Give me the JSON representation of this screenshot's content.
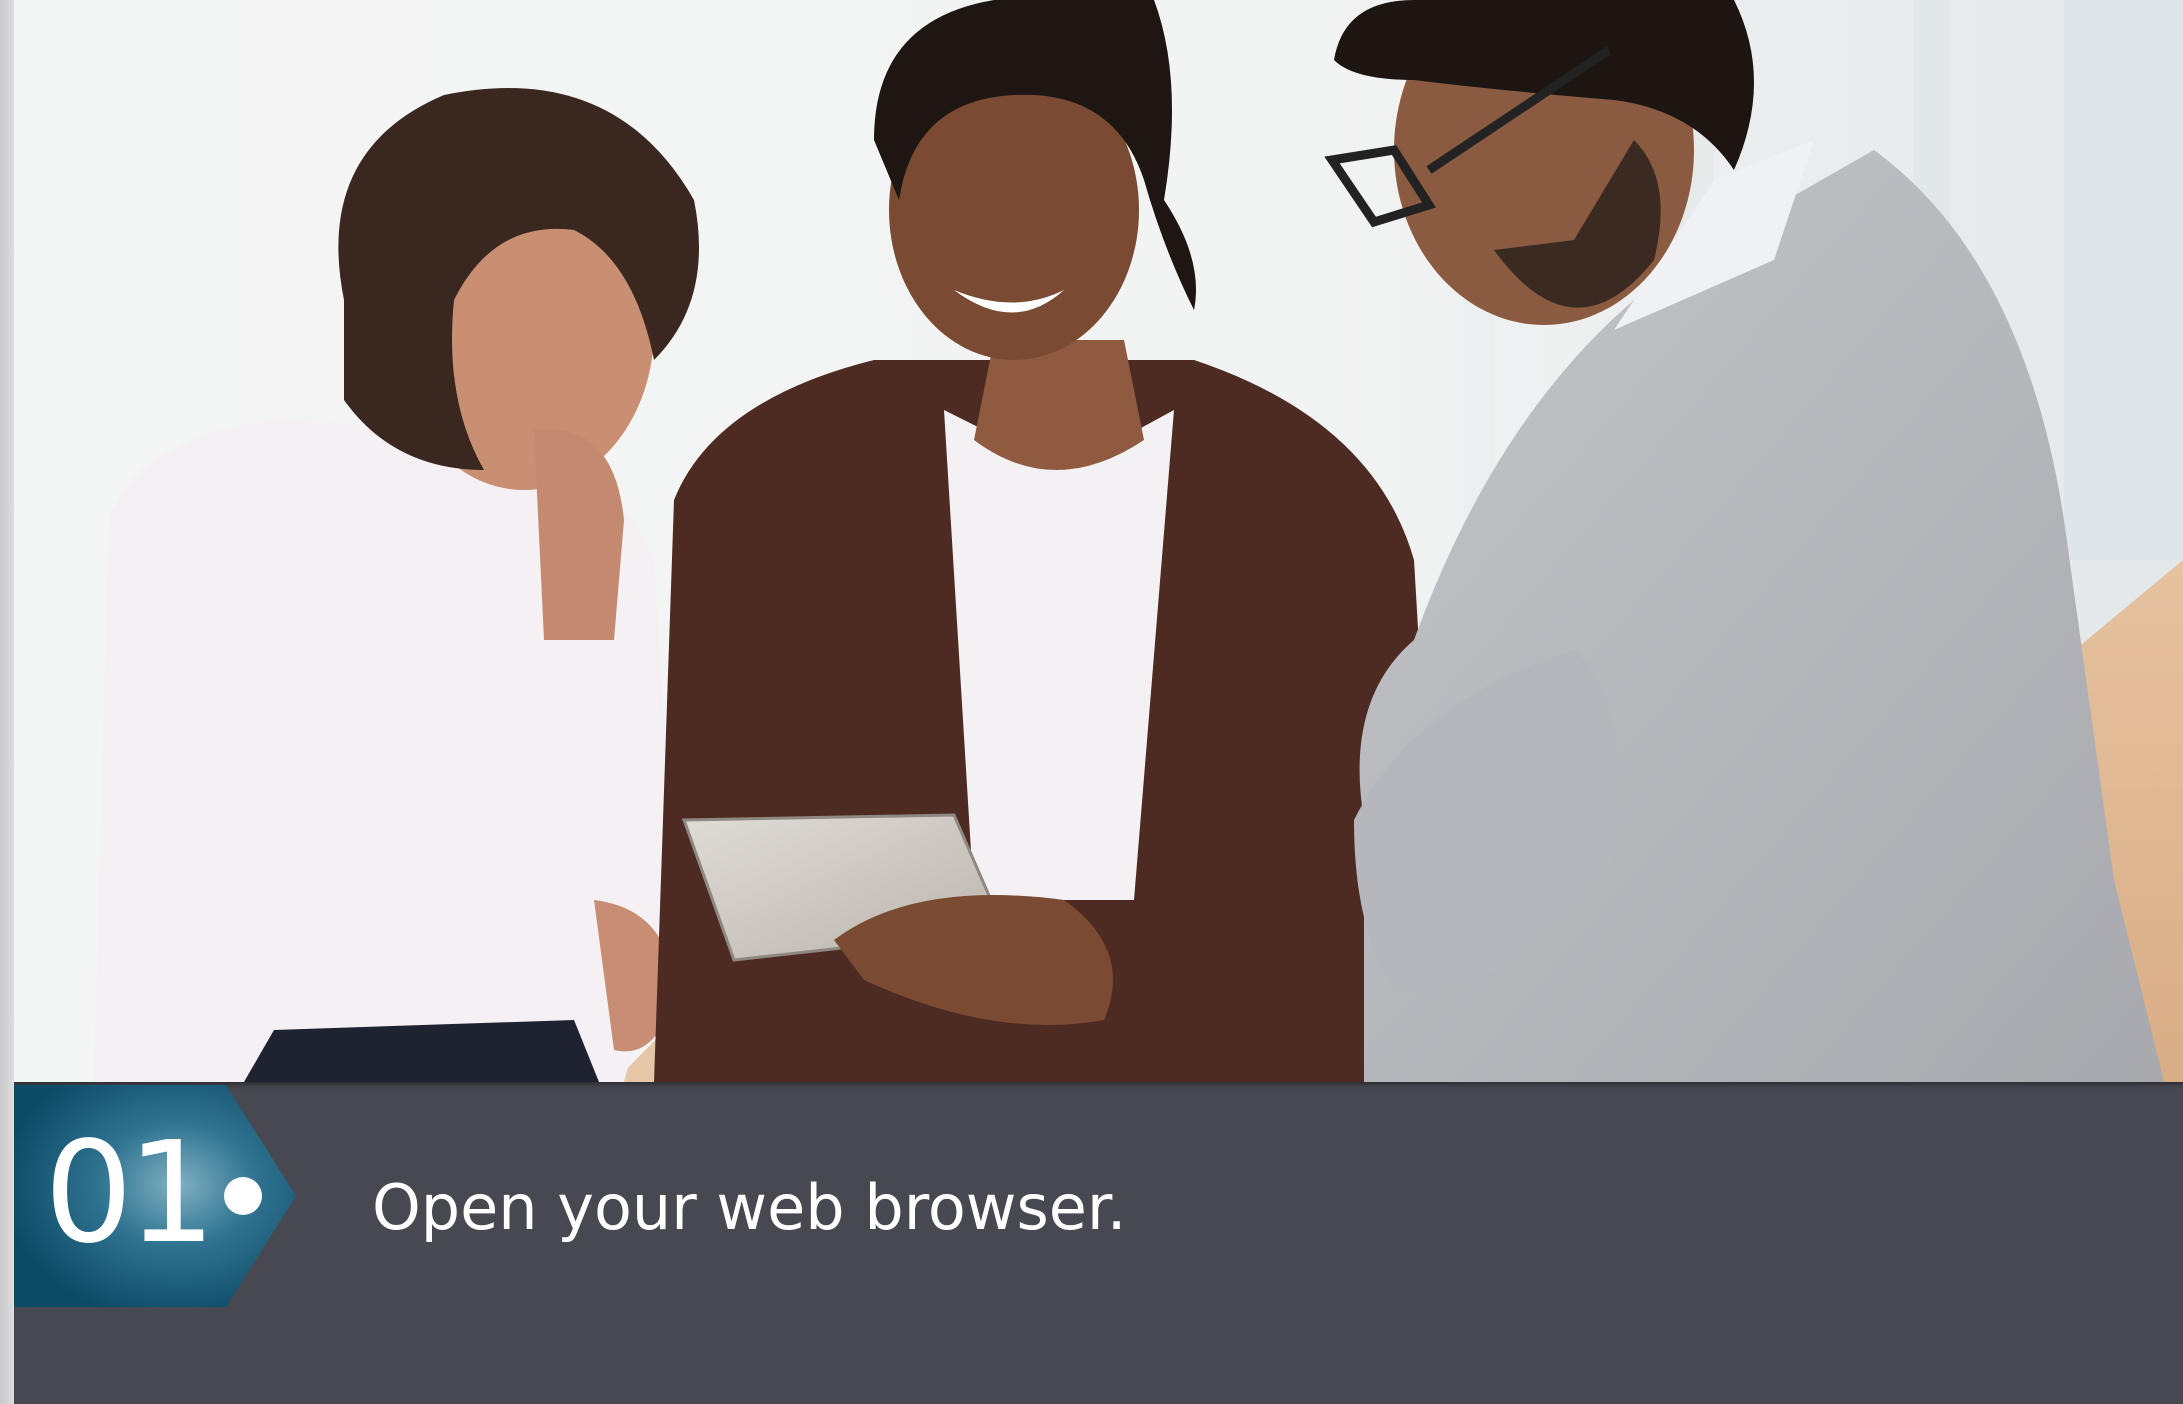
{
  "step": {
    "number": "01",
    "text": "Open your web browser."
  },
  "colors": {
    "band": "#474850",
    "badge_dark": "#0f4f6b",
    "badge_light": "#5f97ad",
    "text": "#ffffff"
  }
}
